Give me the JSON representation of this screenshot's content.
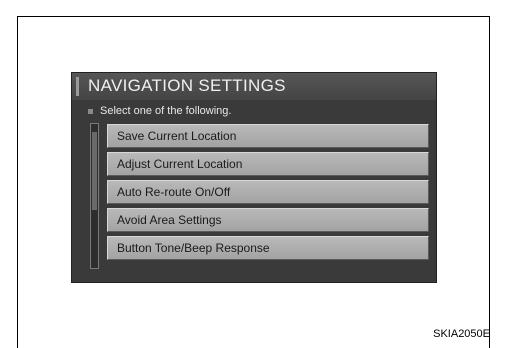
{
  "screen": {
    "title": "NAVIGATION SETTINGS",
    "prompt": "Select one of the following.",
    "menu_items": [
      {
        "label": "Save Current Location"
      },
      {
        "label": "Adjust Current Location"
      },
      {
        "label": "Auto Re-route On/Off"
      },
      {
        "label": "Avoid Area Settings"
      },
      {
        "label": "Button Tone/Beep Response"
      }
    ]
  },
  "caption": "SKIA2050E"
}
